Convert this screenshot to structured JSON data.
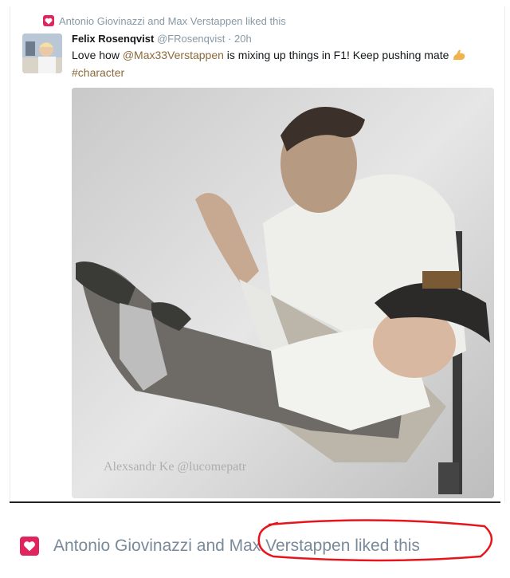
{
  "social_context": {
    "icon": "heart-icon",
    "text": "Antonio Giovinazzi and Max Verstappen liked this"
  },
  "tweet": {
    "author_name": "Felix Rosenqvist",
    "handle": "@FRosenqvist",
    "separator": "·",
    "time": "20h",
    "text_before": "Love how ",
    "mention": "@Max33Verstappen",
    "text_after": " is mixing up things in F1! Keep pushing mate",
    "hashtag": "#character",
    "emoji": "flexed-biceps-icon",
    "image_watermark": "Alexsandr Ke @lucomepatr"
  },
  "zoomed_context": {
    "icon": "heart-icon",
    "text": "Antonio Giovinazzi and Max Verstappen liked this",
    "annotation_color": "#e8141c"
  },
  "colors": {
    "heart": "#e0245e",
    "muted_text": "#8899a6",
    "link": "#8b6a3c"
  }
}
